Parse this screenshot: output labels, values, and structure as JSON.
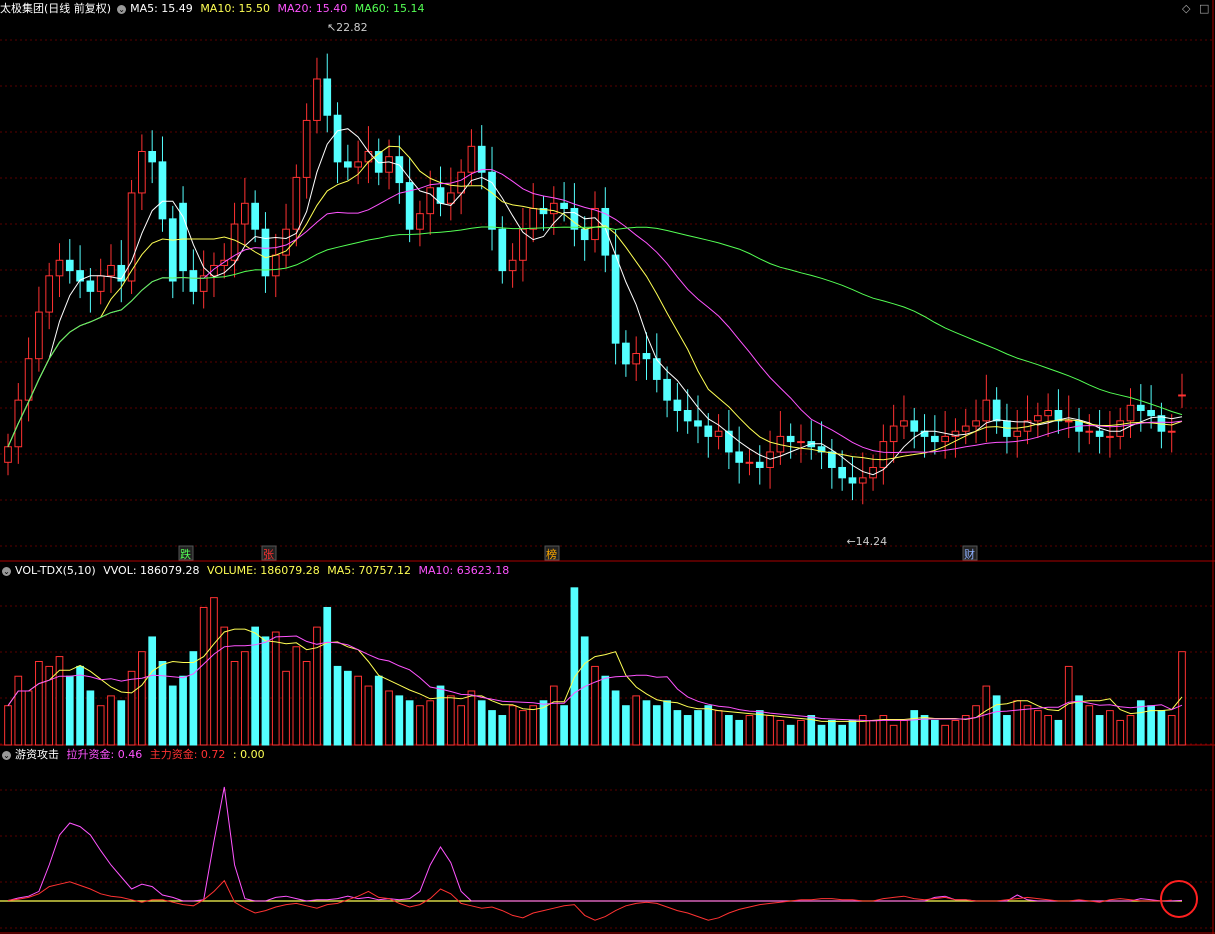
{
  "main": {
    "stock_title": "太极集团(日线 前复权)",
    "ma5": "MA5: 15.49",
    "ma10": "MA10: 15.50",
    "ma20": "MA20: 15.40",
    "ma60": "MA60: 15.14",
    "high_label": "22.82",
    "low_label": "14.24",
    "markers": [
      "跌",
      "张",
      "榜",
      "财"
    ]
  },
  "volume": {
    "indicator": "VOL-TDX(5,10)",
    "vvol": "VVOL: 186079.28",
    "volume": "VOLUME: 186079.28",
    "ma5": "MA5: 70757.12",
    "ma10": "MA10: 63623.18"
  },
  "sub": {
    "title": "游资攻击",
    "lift": "拉升资金: 0.46",
    "main_fund": "主力资金: 0.72",
    "zero": ": 0.00"
  },
  "colors": {
    "up": "#ff3232",
    "down": "#54ffff",
    "ma5": "#ffffff",
    "ma10": "#ffff54",
    "ma20": "#ff54ff",
    "ma60": "#54ff54",
    "grid": "#5a0000"
  },
  "chart_data": [
    {
      "type": "candlestick",
      "title": "太极集团(日线 前复权)",
      "ylim": [
        13.5,
        23.5
      ],
      "series": [
        {
          "name": "price",
          "open": [
            15.0,
            15.3,
            16.2,
            17.0,
            17.9,
            18.6,
            18.9,
            18.7,
            18.5,
            18.3,
            18.6,
            18.8,
            18.5,
            20.2,
            21.0,
            20.8,
            19.7,
            20.0,
            18.7,
            18.3,
            18.6,
            18.8,
            18.9,
            19.6,
            20.0,
            19.5,
            18.6,
            19.0,
            19.5,
            20.5,
            21.6,
            22.4,
            21.7,
            20.8,
            20.7,
            20.8,
            21.0,
            20.6,
            20.9,
            20.4,
            19.5,
            19.8,
            20.3,
            20.0,
            20.2,
            20.6,
            21.1,
            20.6,
            19.5,
            18.7,
            18.9,
            19.5,
            19.9,
            19.8,
            20.0,
            19.9,
            19.5,
            19.3,
            19.9,
            19.0,
            17.3,
            16.9,
            17.1,
            17.0,
            16.6,
            16.2,
            16.0,
            15.8,
            15.7,
            15.5,
            15.6,
            15.2,
            15.0,
            15.0,
            14.9,
            15.2,
            15.5,
            15.4,
            15.4,
            15.3,
            15.2,
            14.9,
            14.7,
            14.6,
            14.7,
            14.9,
            15.4,
            15.7,
            15.8,
            15.6,
            15.5,
            15.4,
            15.5,
            15.6,
            15.7,
            15.8,
            16.2,
            15.8,
            15.5,
            15.6,
            15.8,
            15.9,
            16.0,
            15.8,
            15.8,
            15.6,
            15.6,
            15.5,
            15.5,
            15.8,
            16.1,
            16.0,
            15.9,
            15.6,
            16.3
          ],
          "close": [
            15.3,
            16.2,
            17.0,
            17.9,
            18.6,
            18.9,
            18.7,
            18.5,
            18.3,
            18.6,
            18.8,
            18.5,
            20.2,
            21.0,
            20.8,
            19.7,
            18.5,
            18.7,
            18.3,
            18.6,
            18.8,
            18.9,
            19.6,
            20.0,
            19.5,
            18.6,
            19.0,
            19.5,
            20.5,
            21.6,
            22.4,
            21.7,
            20.8,
            20.7,
            20.8,
            21.0,
            20.6,
            20.9,
            20.4,
            19.5,
            19.8,
            20.3,
            20.0,
            20.2,
            20.6,
            21.1,
            20.6,
            19.5,
            18.7,
            18.9,
            19.5,
            19.9,
            19.8,
            20.0,
            19.9,
            19.5,
            19.3,
            19.9,
            19.0,
            17.3,
            16.9,
            17.1,
            17.0,
            16.6,
            16.2,
            16.0,
            15.8,
            15.7,
            15.5,
            15.6,
            15.2,
            15.0,
            15.0,
            14.9,
            15.2,
            15.5,
            15.4,
            15.4,
            15.3,
            15.2,
            14.9,
            14.7,
            14.6,
            14.7,
            14.9,
            15.4,
            15.7,
            15.8,
            15.6,
            15.5,
            15.4,
            15.5,
            15.6,
            15.7,
            15.8,
            16.2,
            15.8,
            15.5,
            15.6,
            15.8,
            15.9,
            16.0,
            15.8,
            15.8,
            15.6,
            15.6,
            15.5,
            15.5,
            15.8,
            16.1,
            16.0,
            15.9,
            15.6,
            15.6,
            16.3
          ]
        }
      ]
    },
    {
      "type": "bar",
      "title": "VOL-TDX(5,10)",
      "values": [
        40,
        70,
        55,
        85,
        80,
        90,
        70,
        80,
        55,
        40,
        50,
        45,
        75,
        95,
        110,
        85,
        60,
        70,
        95,
        140,
        150,
        120,
        85,
        95,
        120,
        110,
        115,
        75,
        100,
        85,
        120,
        140,
        80,
        75,
        70,
        60,
        70,
        55,
        50,
        45,
        40,
        45,
        60,
        50,
        40,
        55,
        45,
        35,
        30,
        40,
        35,
        40,
        45,
        60,
        40,
        160,
        110,
        80,
        70,
        55,
        40,
        50,
        45,
        40,
        45,
        35,
        30,
        35,
        40,
        35,
        30,
        25,
        30,
        35,
        30,
        25,
        20,
        25,
        30,
        20,
        25,
        20,
        25,
        30,
        25,
        30,
        20,
        25,
        35,
        30,
        25,
        20,
        25,
        30,
        40,
        60,
        50,
        30,
        45,
        40,
        35,
        30,
        25,
        80,
        50,
        40,
        30,
        35,
        25,
        30,
        45,
        40,
        35,
        30,
        95
      ],
      "ylim": [
        0,
        170
      ]
    },
    {
      "type": "line",
      "title": "游资攻击",
      "series": [
        {
          "name": "拉升资金",
          "values": [
            0.3,
            2.5,
            4,
            8,
            30,
            55,
            65,
            62,
            55,
            42,
            30,
            20,
            10,
            14,
            12,
            5,
            3,
            0,
            0,
            1,
            50,
            95,
            30,
            2,
            0,
            0,
            3,
            4,
            2,
            0,
            1,
            1,
            2,
            4,
            2,
            3,
            1,
            2,
            1,
            2,
            8,
            30,
            45,
            32,
            8,
            0,
            0,
            0,
            0,
            0,
            0,
            0,
            0,
            0,
            0,
            0,
            0,
            0,
            0,
            0,
            0,
            0,
            0,
            0,
            0,
            0,
            0,
            0,
            0,
            0,
            0,
            0,
            0,
            0,
            0,
            0,
            0,
            0,
            0,
            0,
            0,
            0,
            0,
            0,
            0,
            0,
            0,
            0,
            0,
            0,
            3,
            4,
            1,
            1,
            0,
            0,
            0,
            0,
            5,
            1,
            0,
            0,
            0,
            0,
            0,
            0,
            0,
            0,
            0,
            0,
            2,
            1,
            0,
            0,
            0.46
          ]
        },
        {
          "name": "主力资金",
          "values": [
            0.5,
            1.5,
            3,
            6,
            12,
            14,
            16,
            13,
            10,
            6,
            4,
            3,
            1,
            -1,
            1,
            1,
            -1,
            -3,
            -4,
            1,
            8,
            17,
            -1,
            -6,
            -10,
            -8,
            -5,
            -3,
            -2,
            -4,
            -6,
            -3,
            -2,
            1,
            4,
            8,
            3,
            2,
            -2,
            -5,
            -3,
            2,
            10,
            6,
            -2,
            -4,
            -6,
            -5,
            -8,
            -12,
            -14,
            -10,
            -8,
            -6,
            -4,
            -3,
            -12,
            -16,
            -13,
            -8,
            -4,
            -2,
            -1,
            -2,
            -5,
            -8,
            -10,
            -13,
            -16,
            -14,
            -10,
            -7,
            -5,
            -3,
            -2,
            -1,
            0,
            1,
            1,
            2,
            2,
            1,
            1,
            0,
            0,
            2,
            3,
            4,
            2,
            1,
            2,
            3,
            1,
            1,
            0,
            0,
            0,
            1,
            2,
            3,
            2,
            1,
            0,
            0,
            1,
            0,
            -1,
            1,
            2,
            1,
            0,
            0,
            0,
            0.72
          ]
        }
      ]
    }
  ]
}
